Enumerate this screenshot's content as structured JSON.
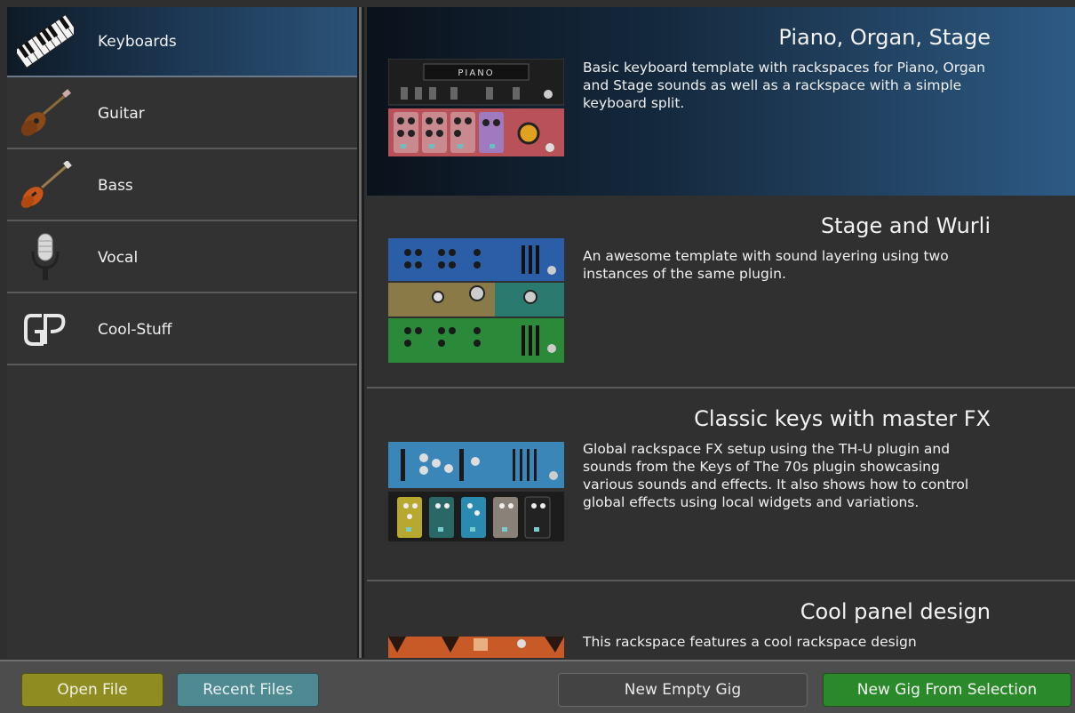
{
  "sidebar": {
    "categories": [
      {
        "label": "Keyboards",
        "icon": "keyboard-icon",
        "selected": true
      },
      {
        "label": "Guitar",
        "icon": "guitar-icon",
        "selected": false
      },
      {
        "label": "Bass",
        "icon": "bass-guitar-icon",
        "selected": false
      },
      {
        "label": "Vocal",
        "icon": "microphone-icon",
        "selected": false
      },
      {
        "label": "Cool-Stuff",
        "icon": "gp-logo-icon",
        "selected": false
      }
    ]
  },
  "templates": [
    {
      "title": "Piano, Organ, Stage",
      "description": "Basic keyboard template with rackspaces for Piano, Organ and Stage sounds as well as a rackspace with a simple keyboard split.",
      "thumb_text": "PIANO",
      "selected": true
    },
    {
      "title": "Stage and Wurli",
      "description": "An awesome template with sound layering using two instances of the same plugin.",
      "selected": false
    },
    {
      "title": "Classic keys with master FX",
      "description": "Global rackspace FX setup using the TH-U plugin and sounds from the Keys of The 70s plugin showcasing various sounds and effects. It also shows how to control global effects using local widgets and variations.",
      "selected": false
    },
    {
      "title": "Cool panel design",
      "description": "This rackspace features a cool rackspace design",
      "selected": false
    }
  ],
  "buttons": {
    "open_file": "Open File",
    "recent_files": "Recent Files",
    "new_empty_gig": "New Empty Gig",
    "new_gig_from_selection": "New Gig From Selection"
  },
  "colors": {
    "selection_accent": "#2d5a85",
    "open_file": "#8f8d22",
    "recent_files": "#4f8a93",
    "new_gig_from_selection": "#2a8a2a"
  }
}
